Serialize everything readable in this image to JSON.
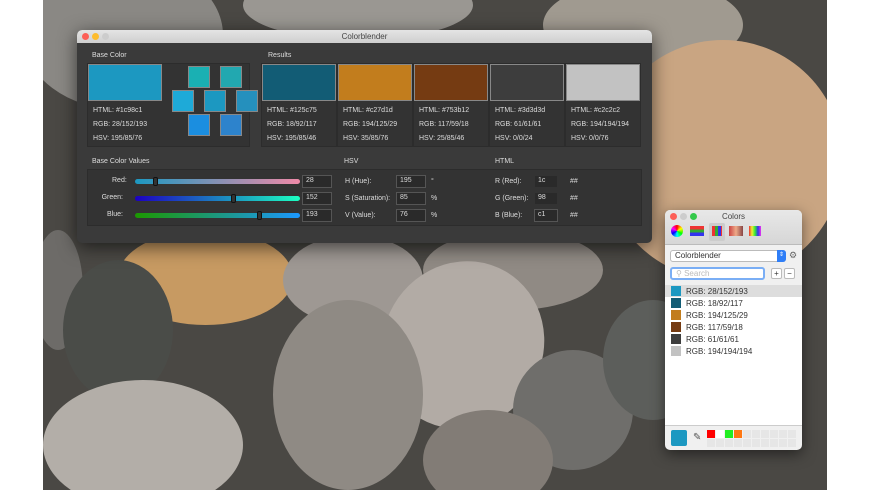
{
  "window": {
    "title": "Colorblender"
  },
  "base": {
    "section": "Base Color",
    "color": "#1c98c1",
    "html": "HTML: #1c98c1",
    "rgb": "RGB: 28/152/193",
    "hsv": "HSV: 195/85/76",
    "variants": [
      "#1ab0b3",
      "#22a8b0",
      "#1eaad8",
      "#1c98c1",
      "#2590bd",
      "#1b8ee0",
      "#2d83cc"
    ]
  },
  "results": {
    "section": "Results",
    "items": [
      {
        "color": "#125c75",
        "html": "HTML: #125c75",
        "rgb": "RGB: 18/92/117",
        "hsv": "HSV: 195/85/46"
      },
      {
        "color": "#c27d1d",
        "html": "HTML: #c27d1d",
        "rgb": "RGB: 194/125/29",
        "hsv": "HSV: 35/85/76"
      },
      {
        "color": "#753b12",
        "html": "HTML: #753b12",
        "rgb": "RGB: 117/59/18",
        "hsv": "HSV: 25/85/46"
      },
      {
        "color": "#3d3d3d",
        "html": "HTML: #3d3d3d",
        "rgb": "RGB: 61/61/61",
        "hsv": "HSV: 0/0/24"
      },
      {
        "color": "#c2c2c2",
        "html": "HTML: #c2c2c2",
        "rgb": "RGB: 194/194/194",
        "hsv": "HSV: 0/0/76"
      }
    ]
  },
  "values": {
    "section": "Base Color Values",
    "red_label": "Red:",
    "green_label": "Green:",
    "blue_label": "Blue:",
    "red": "28",
    "green": "152",
    "blue": "193",
    "red_frac": 0.11,
    "green_frac": 0.6,
    "blue_frac": 0.76
  },
  "hsv": {
    "section": "HSV",
    "h_label": "H (Hue):",
    "s_label": "S (Saturation):",
    "v_label": "V (Value):",
    "h": "195",
    "s": "85",
    "v": "76",
    "h_unit": "°",
    "s_unit": "%",
    "v_unit": "%"
  },
  "html": {
    "section": "HTML",
    "r_label": "R (Red):",
    "g_label": "G (Green):",
    "b_label": "B (Blue):",
    "r": "1c",
    "g": "98",
    "b": "c1",
    "unit": "##"
  },
  "colors_panel": {
    "title": "Colors",
    "palette": "Colorblender",
    "search_placeholder": "Search",
    "add": "+",
    "remove": "−",
    "items": [
      {
        "color": "#1c98c1",
        "label": "RGB: 28/152/193"
      },
      {
        "color": "#125c75",
        "label": "RGB: 18/92/117"
      },
      {
        "color": "#c27d1d",
        "label": "RGB: 194/125/29"
      },
      {
        "color": "#753b12",
        "label": "RGB: 117/59/18"
      },
      {
        "color": "#3d3d3d",
        "label": "RGB: 61/61/61"
      },
      {
        "color": "#c2c2c2",
        "label": "RGB: 194/194/194"
      }
    ],
    "current": "#1c98c1",
    "favorites": [
      "#ff0000",
      "#ffffff",
      "#22ee22",
      "#ff7711"
    ]
  }
}
